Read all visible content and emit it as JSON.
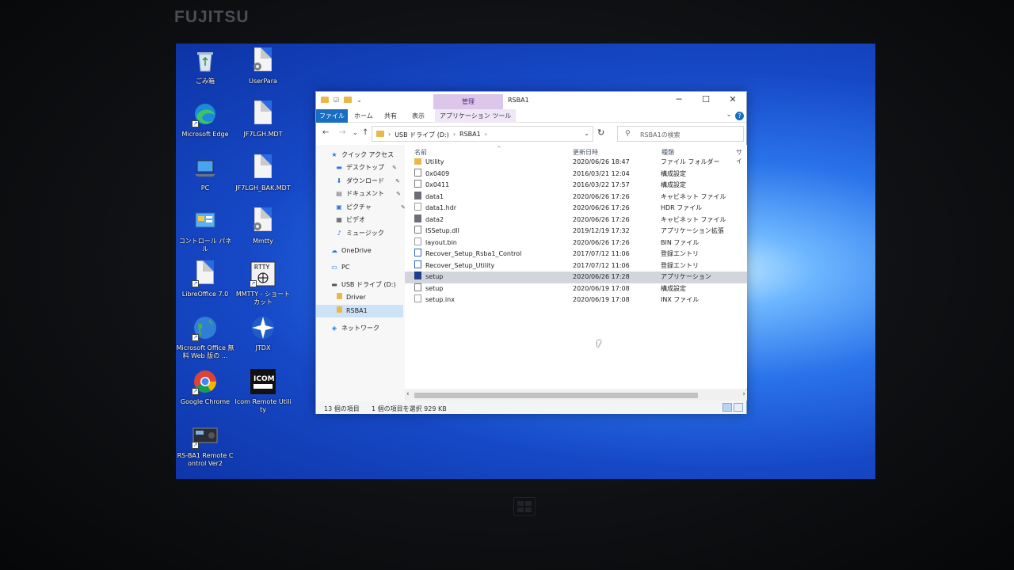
{
  "monitor": {
    "brand": "FUJITSU"
  },
  "desktop": {
    "icons": [
      {
        "label": "ごみ箱",
        "icon": "recycle-bin-icon"
      },
      {
        "label": "UserPara",
        "icon": "config-file-icon"
      },
      {
        "label": "Microsoft Edge",
        "icon": "edge-icon"
      },
      {
        "label": "JF7LGH.MDT",
        "icon": "file-icon"
      },
      {
        "label": "PC",
        "icon": "pc-icon"
      },
      {
        "label": "JF7LGH_BAK.MDT",
        "icon": "file-icon"
      },
      {
        "label": "コントロール パネル",
        "icon": "control-panel-icon"
      },
      {
        "label": "Mmtty",
        "icon": "config-file-icon"
      },
      {
        "label": "LibreOffice 7.0",
        "icon": "libreoffice-icon"
      },
      {
        "label": "MMTTY - ショートカット",
        "icon": "mmtty-icon"
      },
      {
        "label": "Microsoft Office 無料 Web 版の ...",
        "icon": "office-globe-icon"
      },
      {
        "label": "JTDX",
        "icon": "jtdx-icon"
      },
      {
        "label": "Google Chrome",
        "icon": "chrome-icon"
      },
      {
        "label": "Icom Remote Utility",
        "icon": "icom-remote-icon"
      },
      {
        "label": "RS-BA1 Remote Control Ver2",
        "icon": "rsba1-icon"
      }
    ]
  },
  "explorer": {
    "title": "RSBA1",
    "context_tab_header": "管理",
    "caption_buttons": {
      "minimize": "─",
      "maximize": "☐",
      "close": "✕"
    },
    "ribbon_tabs": [
      "ファイル",
      "ホーム",
      "共有",
      "表示",
      "アプリケーション ツール"
    ],
    "address": {
      "crumbs": [
        "USB ドライブ (D:)",
        "RSBA1"
      ],
      "separator": "›",
      "dropdown": "⌄",
      "refresh": "↻"
    },
    "nav_buttons": {
      "back": "←",
      "forward": "→",
      "recent": "⌄",
      "up": "↑"
    },
    "search": {
      "placeholder": "RSBA1の検索",
      "icon": "search-icon"
    },
    "nav_pane": [
      {
        "label": "クイック アクセス",
        "icon": "star-icon",
        "pinned": false
      },
      {
        "label": "デスクトップ",
        "icon": "desktop-folder-icon",
        "pinned": true
      },
      {
        "label": "ダウンロード",
        "icon": "download-icon",
        "pinned": true
      },
      {
        "label": "ドキュメント",
        "icon": "documents-icon",
        "pinned": true
      },
      {
        "label": "ピクチャ",
        "icon": "pictures-icon",
        "pinned": true
      },
      {
        "label": "ビデオ",
        "icon": "video-icon",
        "pinned": false
      },
      {
        "label": "ミュージック",
        "icon": "music-icon",
        "pinned": false
      },
      {
        "label": "OneDrive",
        "icon": "cloud-icon",
        "pinned": false
      },
      {
        "label": "PC",
        "icon": "pc-icon",
        "pinned": false
      },
      {
        "label": "USB ドライブ (D:)",
        "icon": "usb-drive-icon",
        "pinned": false
      },
      {
        "label": "Driver",
        "icon": "folder-icon",
        "pinned": false
      },
      {
        "label": "RSBA1",
        "icon": "folder-icon",
        "pinned": false,
        "selected": true
      },
      {
        "label": "ネットワーク",
        "icon": "network-icon",
        "pinned": false
      }
    ],
    "columns": {
      "name": "名前",
      "modified": "更新日時",
      "type": "種類",
      "size": "サイ"
    },
    "files": [
      {
        "name": "Utility",
        "modified": "2020/06/26 18:47",
        "type": "ファイル フォルダー",
        "icon": "folder-icon"
      },
      {
        "name": "0x0409",
        "modified": "2016/03/21 12:04",
        "type": "構成設定",
        "icon": "config-file-icon"
      },
      {
        "name": "0x0411",
        "modified": "2016/03/22 17:57",
        "type": "構成設定",
        "icon": "config-file-icon"
      },
      {
        "name": "data1",
        "modified": "2020/06/26 17:26",
        "type": "キャビネット ファイル",
        "icon": "cabinet-file-icon"
      },
      {
        "name": "data1.hdr",
        "modified": "2020/06/26 17:26",
        "type": "HDR ファイル",
        "icon": "file-icon"
      },
      {
        "name": "data2",
        "modified": "2020/06/26 17:26",
        "type": "キャビネット ファイル",
        "icon": "cabinet-file-icon"
      },
      {
        "name": "ISSetup.dll",
        "modified": "2019/12/19 17:32",
        "type": "アプリケーション拡張",
        "icon": "dll-file-icon"
      },
      {
        "name": "layout.bin",
        "modified": "2020/06/26 17:26",
        "type": "BIN ファイル",
        "icon": "file-icon"
      },
      {
        "name": "Recover_Setup_Rsba1_Control",
        "modified": "2017/07/12 11:06",
        "type": "登録エントリ",
        "icon": "registry-file-icon"
      },
      {
        "name": "Recover_Setup_Utility",
        "modified": "2017/07/12 11:06",
        "type": "登録エントリ",
        "icon": "registry-file-icon"
      },
      {
        "name": "setup",
        "modified": "2020/06/26 17:28",
        "type": "アプリケーション",
        "icon": "setup-app-icon",
        "selected": true
      },
      {
        "name": "setup",
        "modified": "2020/06/19 17:08",
        "type": "構成設定",
        "icon": "config-file-icon"
      },
      {
        "name": "setup.inx",
        "modified": "2020/06/19 17:08",
        "type": "INX ファイル",
        "icon": "file-icon"
      }
    ],
    "status": {
      "item_count": "13 個の項目",
      "selection": "1 個の項目を選択  929 KB"
    }
  }
}
